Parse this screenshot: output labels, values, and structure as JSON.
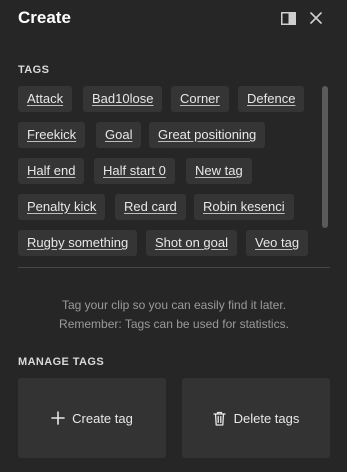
{
  "header": {
    "title": "Create",
    "icons": [
      "panel-toggle-icon",
      "close-icon"
    ]
  },
  "tags_section": {
    "label": "TAGS",
    "tags": [
      "Attack",
      "Bad10lose",
      "Corner",
      "Defence",
      "Freekick",
      "Goal",
      "Great positioning",
      "Half end",
      "Half start 0",
      "New tag",
      "Penalty kick",
      "Red card",
      "Robin kesenci",
      "Rugby something",
      "Shot on goal",
      "Veo tag"
    ]
  },
  "hint": {
    "line1": "Tag your clip so you can easily find it later.",
    "line2": "Remember: Tags can be used for statistics."
  },
  "manage_section": {
    "label": "MANAGE TAGS",
    "create_label": "Create tag",
    "delete_label": "Delete tags",
    "create_icon": "plus-icon",
    "delete_icon": "trash-icon"
  },
  "colors": {
    "background": "#262626",
    "tag_background": "#353535",
    "card_background": "#333333"
  }
}
